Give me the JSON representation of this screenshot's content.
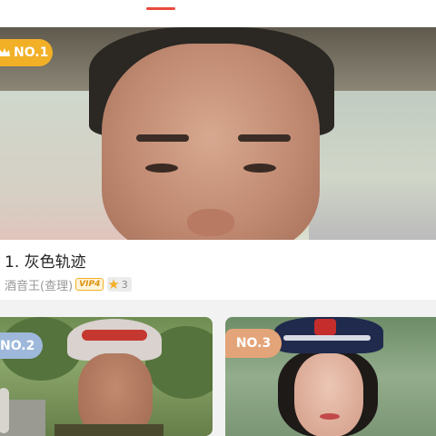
{
  "header": {
    "active_tab_indicator_color": "#ea4b3d"
  },
  "featured": {
    "rank_badge": "NO.1",
    "rank_icon": "crown-icon",
    "title": "1. 灰色轨迹",
    "author": "酒音王(查理)",
    "vip_label": "VIP4",
    "star_icon": "star-icon",
    "star_count": "3"
  },
  "ranking": [
    {
      "rank_badge": "NO.2",
      "badge_color": "#9db8da"
    },
    {
      "rank_badge": "NO.3",
      "badge_color": "#e4a479"
    }
  ],
  "colors": {
    "gold_badge": "#f2b027",
    "background": "#f2f2f2"
  }
}
